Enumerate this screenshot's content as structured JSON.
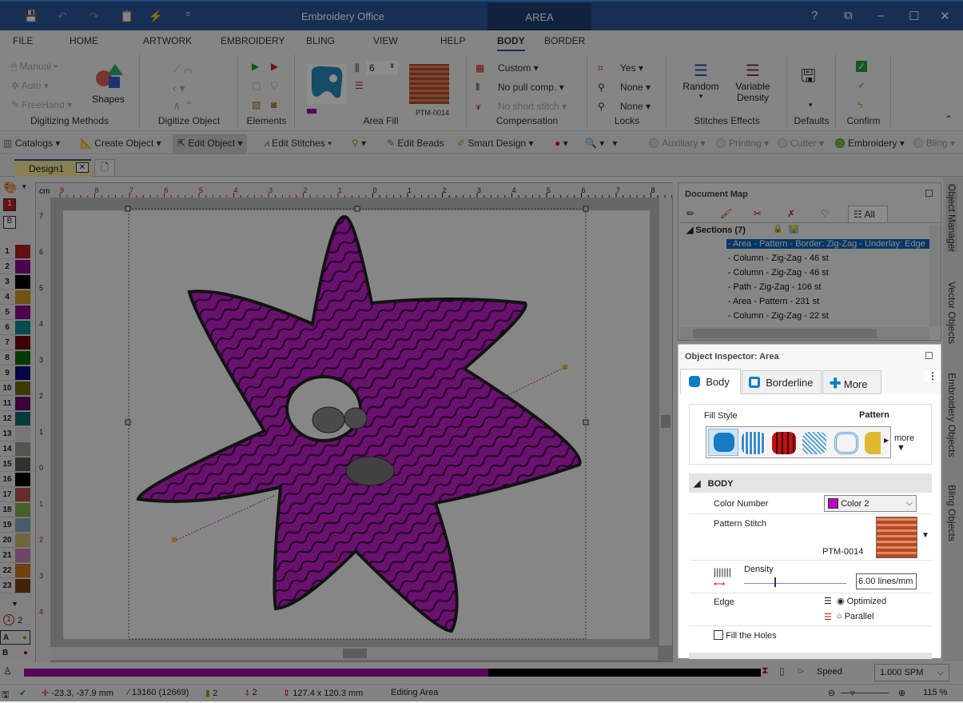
{
  "app": {
    "title": "Embroidery Office",
    "context_tab": "AREA"
  },
  "window_controls": [
    "?",
    "⧉",
    "–",
    "☐",
    "✕"
  ],
  "menu": [
    "FILE",
    "HOME",
    "ARTWORK",
    "EMBROIDERY",
    "BLING",
    "VIEW",
    "HELP",
    "BODY",
    "BORDER"
  ],
  "menu_active": "BODY",
  "ribbon": {
    "digitizing_methods": {
      "label": "Digitizing Methods",
      "items": [
        "Manual",
        "Auto",
        "FreeHand"
      ],
      "shapes": "Shapes"
    },
    "digitize_object": {
      "label": "Digitize Object"
    },
    "elements": {
      "label": "Elements"
    },
    "area_fill": {
      "label": "Area Fill",
      "density_value": "6",
      "pattern": "PTM-0014"
    },
    "compensation": {
      "label": "Compensation",
      "items": [
        "Custom",
        "No pull comp.",
        "No short stitch"
      ]
    },
    "locks": {
      "label": "Locks",
      "items": [
        "Yes",
        "None",
        "None"
      ]
    },
    "stitches_effects": {
      "label": "Stitches Effects",
      "random": "Random",
      "variable_density": "Variable Density"
    },
    "defaults": {
      "label": "Defaults"
    },
    "confirm": {
      "label": "Confirm"
    }
  },
  "toolbar": {
    "catalogs": "Catalogs",
    "create_object": "Create Object",
    "edit_object": "Edit Object",
    "edit_stitches": "Edit Stitches",
    "edit_beads": "Edit Beads",
    "smart_design": "Smart Design",
    "auxiliary": "Auxiliary",
    "printing": "Printing",
    "cutter": "Cutter",
    "embroidery": "Embroidery",
    "bling": "Bling"
  },
  "document_tab": "Design1",
  "palette": {
    "current_color": "1",
    "current_mode": "B",
    "colors": [
      {
        "n": "1",
        "hex": "#b02020"
      },
      {
        "n": "2",
        "hex": "#8a0a8a"
      },
      {
        "n": "3",
        "hex": "#000000"
      },
      {
        "n": "4",
        "hex": "#c89a20"
      },
      {
        "n": "5",
        "hex": "#8a0a8a"
      },
      {
        "n": "6",
        "hex": "#0a8a8a"
      },
      {
        "n": "7",
        "hex": "#6a0008"
      },
      {
        "n": "8",
        "hex": "#0a6a0a"
      },
      {
        "n": "9",
        "hex": "#0a0a7a"
      },
      {
        "n": "10",
        "hex": "#6a6a0a"
      },
      {
        "n": "11",
        "hex": "#6a0a6a"
      },
      {
        "n": "12",
        "hex": "#0a6a6a"
      },
      {
        "n": "13",
        "hex": "#d8d8d8"
      },
      {
        "n": "14",
        "hex": "#9a9a92"
      },
      {
        "n": "15",
        "hex": "#5a5a50"
      },
      {
        "n": "16",
        "hex": "#000000"
      },
      {
        "n": "17",
        "hex": "#c05050"
      },
      {
        "n": "18",
        "hex": "#80b050"
      },
      {
        "n": "19",
        "hex": "#80a8c0"
      },
      {
        "n": "20",
        "hex": "#c8b870"
      },
      {
        "n": "21",
        "hex": "#c880c0"
      },
      {
        "n": "22",
        "hex": "#c87818"
      },
      {
        "n": "23",
        "hex": "#784010"
      }
    ],
    "needle_count": "2",
    "head_a": "A",
    "head_b": "B"
  },
  "ruler": {
    "unit": "cm",
    "top_ticks": [
      "9",
      "8",
      "7",
      "6",
      "5",
      "4",
      "3",
      "2",
      "1",
      "0",
      "1",
      "2",
      "3",
      "4",
      "5",
      "6",
      "7",
      "8"
    ],
    "left_ticks": [
      "7",
      "6",
      "5",
      "4",
      "3",
      "2",
      "1",
      "0",
      "1",
      "2",
      "3",
      "4"
    ]
  },
  "document_map": {
    "title": "Document Map",
    "tab_all": "All",
    "section_header": "Sections (7)",
    "items": [
      {
        "label": "1 - Area - Pattern - Border: Zig-Zag - Underlay: Edge",
        "color": "#8a0a8a",
        "selected": true
      },
      {
        "label": "2 - Column - Zig-Zag - 46 st",
        "color": "#000000"
      },
      {
        "label": "3 - Column - Zig-Zag - 46 st",
        "color": "#000000"
      },
      {
        "label": "4 - Path - Zig-Zag - 106 st",
        "color": "#000000"
      },
      {
        "label": "5 - Area - Pattern - 231 st",
        "color": "#000000"
      },
      {
        "label": "6 - Column - Zig-Zag - 22 st",
        "color": "#a01010"
      }
    ]
  },
  "inspector": {
    "title": "Object Inspector: Area",
    "tabs": [
      "Body",
      "Borderline",
      "More"
    ],
    "fill_style_label": "Fill Style",
    "fill_style_value": "Pattern",
    "more": "more",
    "section": "BODY",
    "color_number_label": "Color Number",
    "color_number_value": "Color 2",
    "color_swatch": "#c000c0",
    "pattern_stitch_label": "Pattern Stitch",
    "pattern_code": "PTM-0014",
    "density_label": "Density",
    "density_value": "6.00 lines/mm",
    "density_slider_fraction": 0.3,
    "edge_label": "Edge",
    "edge_options": [
      "Optimized",
      "Parallel"
    ],
    "edge_selected": "Optimized",
    "fill_holes_label": "Fill the Holes",
    "fill_holes_checked": false
  },
  "side_tabs": [
    "Object Manager",
    "Vector Objects",
    "Embroidery Objects",
    "Bling Objects"
  ],
  "playback": {
    "progress_fraction": 0.63,
    "speed_label": "Speed",
    "speed_value": "1.000 SPM"
  },
  "status": {
    "coords": "-23.3, -37.9 mm",
    "stitches": "13160 (12669)",
    "colors": "2",
    "stops": "2",
    "size": "127.4 x 120.3 mm",
    "mode": "Editing Area",
    "zoom": "115 %"
  },
  "accent": "#2b579a"
}
